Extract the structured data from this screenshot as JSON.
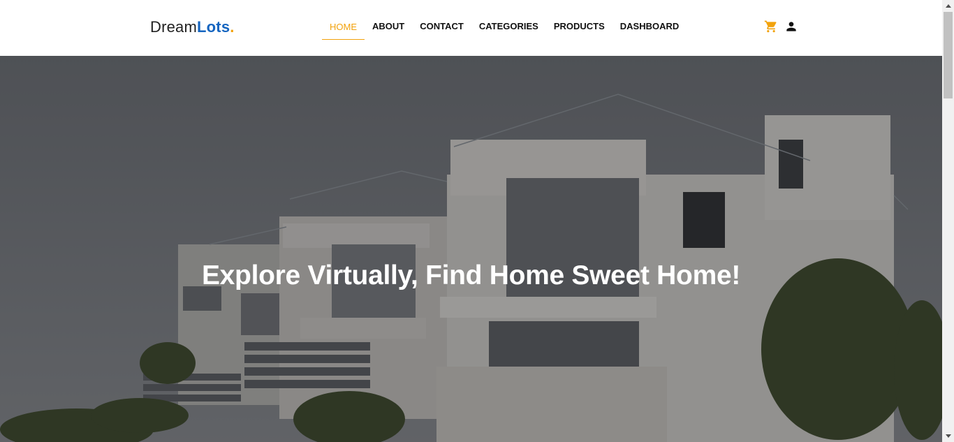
{
  "brand": {
    "part1": "Dream",
    "part2": "Lots",
    "dot": "."
  },
  "nav": {
    "items": [
      {
        "label": "HOME",
        "active": true
      },
      {
        "label": "ABOUT"
      },
      {
        "label": "CONTACT"
      },
      {
        "label": "CATEGORIES"
      },
      {
        "label": "PRODUCTS"
      },
      {
        "label": "DASHBOARD"
      }
    ]
  },
  "icons": {
    "cart": "cart-icon",
    "user": "user-icon"
  },
  "hero": {
    "title": "Explore Virtually, Find Home Sweet Home!"
  },
  "colors": {
    "accent": "#f2a20c",
    "brand_blue": "#1565c0",
    "text": "#111111"
  }
}
